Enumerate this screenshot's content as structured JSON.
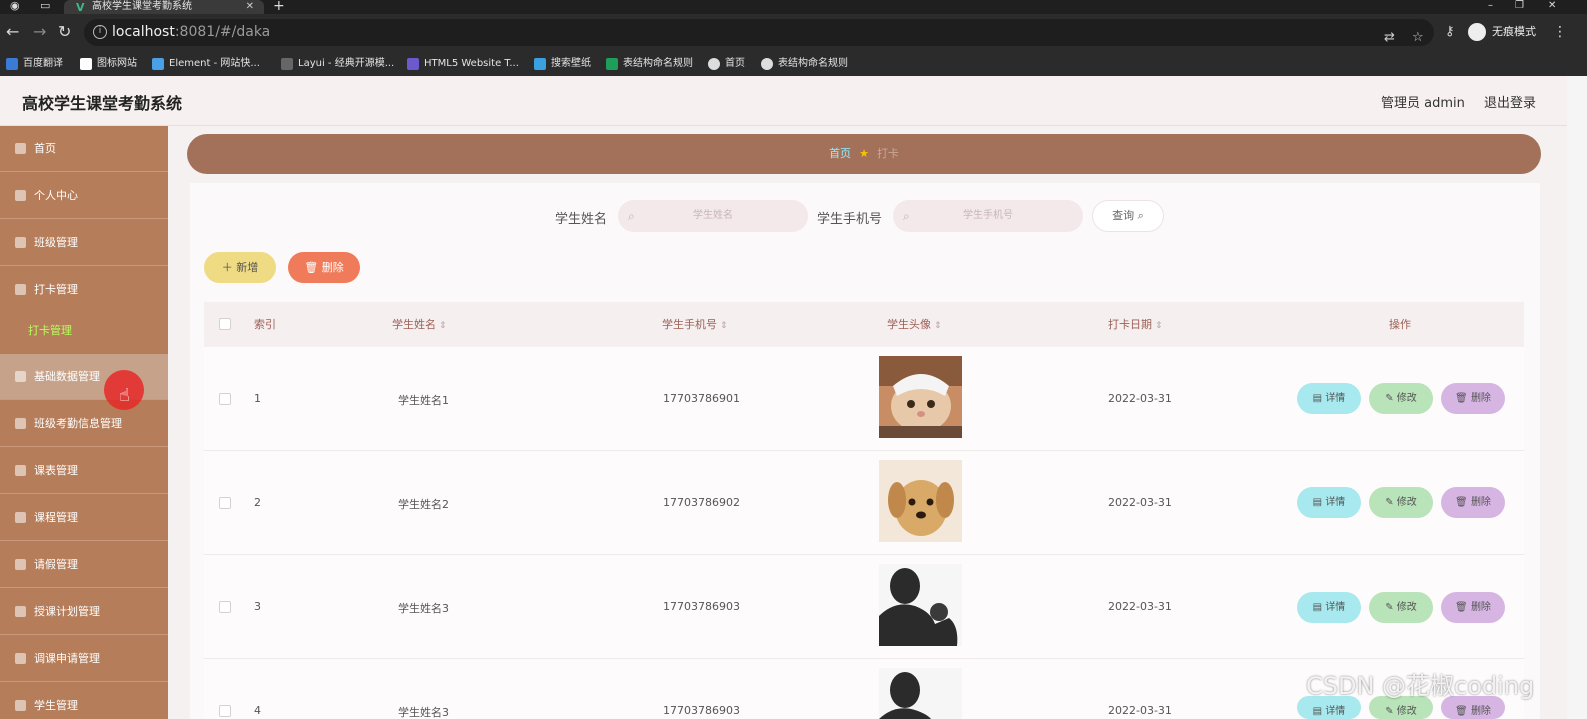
{
  "browser": {
    "tab_title": "高校学生课堂考勤系统",
    "url_host": "localhost",
    "url_path": ":8081/#/daka",
    "profile_label": "无痕模式",
    "bookmarks": [
      "百度翻译",
      "图标网站",
      "Element - 网站快...",
      "Layui - 经典开源模...",
      "HTML5 Website T...",
      "搜索壁纸",
      "表结构命名规则",
      "首页",
      "表结构命名规则"
    ]
  },
  "header": {
    "title": "高校学生课堂考勤系统",
    "user": "管理员 admin",
    "logout": "退出登录"
  },
  "sidebar": {
    "items": [
      "首页",
      "个人中心",
      "班级管理",
      "打卡管理",
      "基础数据管理",
      "班级考勤信息管理",
      "课表管理",
      "课程管理",
      "请假管理",
      "授课计划管理",
      "调课申请管理",
      "学生管理"
    ],
    "submenu": "打卡管理"
  },
  "breadcrumb": {
    "home": "首页",
    "current": "打卡"
  },
  "search": {
    "name_label": "学生姓名",
    "name_placeholder": "学生姓名",
    "phone_label": "学生手机号",
    "phone_placeholder": "学生手机号",
    "query_button": "查询"
  },
  "toolbar": {
    "add": "新增",
    "delete": "删除"
  },
  "table": {
    "columns": [
      "索引",
      "学生姓名",
      "学生手机号",
      "学生头像",
      "打卡日期",
      "操作"
    ],
    "rows": [
      {
        "index": "1",
        "name": "学生姓名1",
        "phone": "17703786901",
        "avatar": "cat-photo",
        "date": "2022-03-31"
      },
      {
        "index": "2",
        "name": "学生姓名2",
        "phone": "17703786902",
        "avatar": "puppy-photo",
        "date": "2022-03-31"
      },
      {
        "index": "3",
        "name": "学生姓名3",
        "phone": "17703786903",
        "avatar": "silhouette-photo",
        "date": "2022-03-31"
      },
      {
        "index": "4",
        "name": "学生姓名3",
        "phone": "17703786903",
        "avatar": "silhouette-photo",
        "date": "2022-03-31"
      }
    ],
    "actions": {
      "detail": "详情",
      "edit": "修改",
      "delete": "删除"
    }
  },
  "watermark": "CSDN @花椒coding",
  "colors": {
    "sidebar": "#b57d5a",
    "breadcrumb_bar": "#a3715a",
    "add_button": "#efdb83",
    "delete_button": "#f07b5a",
    "detail_button": "#a7e9ee",
    "edit_button": "#b9e3b8",
    "remove_button": "#d6b5e3"
  }
}
